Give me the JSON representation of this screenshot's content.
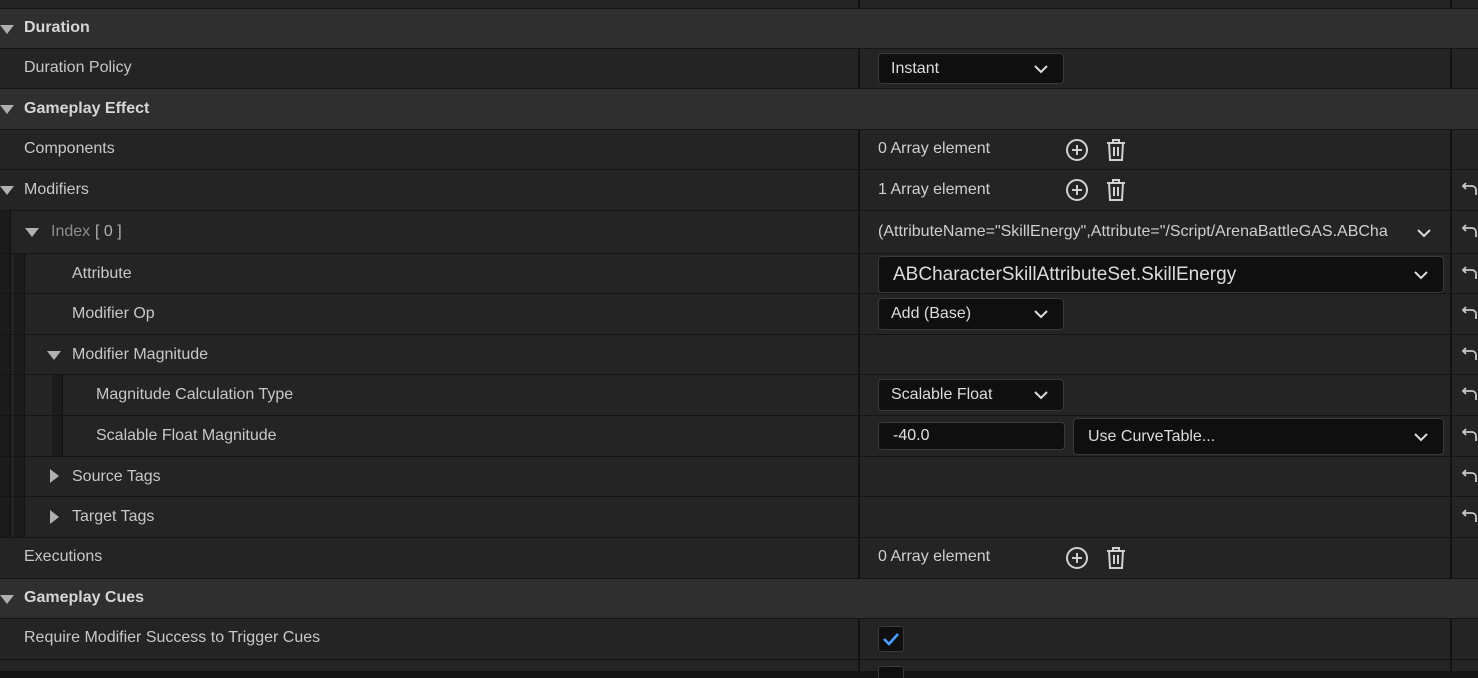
{
  "sections": {
    "duration": "Duration",
    "gameplay_effect": "Gameplay Effect",
    "gameplay_cues": "Gameplay Cues"
  },
  "duration_policy": {
    "label": "Duration Policy",
    "value": "Instant"
  },
  "components": {
    "label": "Components",
    "value": "0 Array element"
  },
  "modifiers": {
    "label": "Modifiers",
    "value": "1 Array element",
    "index_label": "Index",
    "index_bracket": "[ 0 ]",
    "index_value": "(AttributeName=\"SkillEnergy\",Attribute=\"/Script/ArenaBattleGAS.ABCha",
    "attribute": {
      "label": "Attribute",
      "value": "ABCharacterSkillAttributeSet.SkillEnergy"
    },
    "modifier_op": {
      "label": "Modifier Op",
      "value": "Add (Base)"
    },
    "modifier_magnitude": {
      "label": "Modifier Magnitude"
    },
    "magnitude_calc_type": {
      "label": "Magnitude Calculation Type",
      "value": "Scalable Float"
    },
    "scalable_float_magnitude": {
      "label": "Scalable Float Magnitude",
      "value": "-40.0",
      "curve_value": "Use CurveTable..."
    },
    "source_tags": {
      "label": "Source Tags"
    },
    "target_tags": {
      "label": "Target Tags"
    }
  },
  "executions": {
    "label": "Executions",
    "value": "0 Array element"
  },
  "require_modifier_success": {
    "label": "Require Modifier Success to Trigger Cues",
    "checked": true
  },
  "colors": {
    "accent_check": "#4a9eff",
    "background": "#242424",
    "category": "#2f2f2f"
  }
}
